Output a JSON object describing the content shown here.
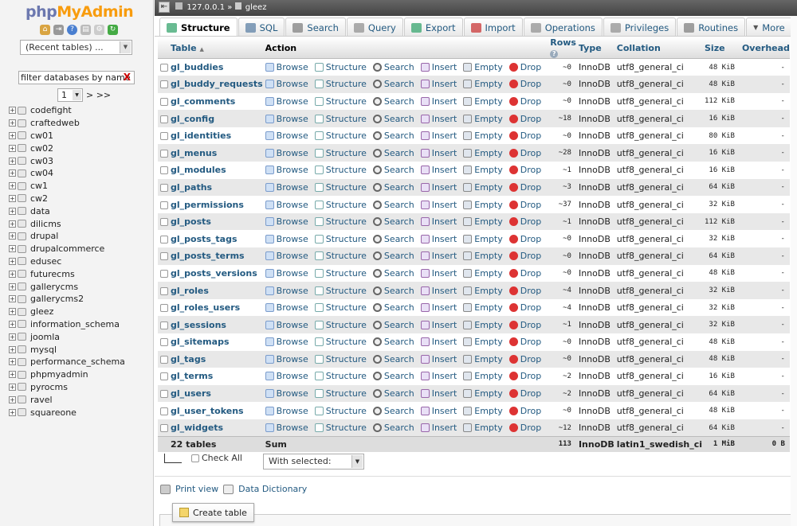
{
  "sidebar": {
    "logo_part1": "php",
    "logo_part2": "MyAdmin",
    "recent_tables": "(Recent tables) ...",
    "filter_placeholder": "filter databases by name",
    "filter_clear": "X",
    "page": "1",
    "page_next": "> >>",
    "databases": [
      "codefight",
      "craftedweb",
      "cw01",
      "cw02",
      "cw03",
      "cw04",
      "cw1",
      "cw2",
      "data",
      "dilicms",
      "drupal",
      "drupalcommerce",
      "edusec",
      "futurecms",
      "gallerycms",
      "gallerycms2",
      "gleez",
      "information_schema",
      "joomla",
      "mysql",
      "performance_schema",
      "phpmyadmin",
      "pyrocms",
      "ravel",
      "squareone"
    ]
  },
  "breadcrumb": {
    "server": "127.0.0.1",
    "sep": "»",
    "database": "gleez"
  },
  "tabs": [
    {
      "label": "Structure",
      "active": true,
      "color": "#4a7"
    },
    {
      "label": "SQL",
      "active": false,
      "color": "#68a"
    },
    {
      "label": "Search",
      "active": false,
      "color": "#888"
    },
    {
      "label": "Query",
      "active": false,
      "color": "#999"
    },
    {
      "label": "Export",
      "active": false,
      "color": "#4a7"
    },
    {
      "label": "Import",
      "active": false,
      "color": "#c44"
    },
    {
      "label": "Operations",
      "active": false,
      "color": "#999"
    },
    {
      "label": "Privileges",
      "active": false,
      "color": "#999"
    },
    {
      "label": "Routines",
      "active": false,
      "color": "#888"
    },
    {
      "label": "More",
      "active": false,
      "color": "#fff"
    }
  ],
  "table_headers": {
    "table": "Table",
    "action": "Action",
    "rows": "Rows",
    "type": "Type",
    "collation": "Collation",
    "size": "Size",
    "overhead": "Overhead"
  },
  "actions": {
    "browse": "Browse",
    "structure": "Structure",
    "search": "Search",
    "insert": "Insert",
    "empty": "Empty",
    "drop": "Drop"
  },
  "tables": [
    {
      "name": "gl_buddies",
      "rows": "~0",
      "type": "InnoDB",
      "collation": "utf8_general_ci",
      "size": "48 KiB",
      "overhead": "-"
    },
    {
      "name": "gl_buddy_requests",
      "rows": "~0",
      "type": "InnoDB",
      "collation": "utf8_general_ci",
      "size": "48 KiB",
      "overhead": "-"
    },
    {
      "name": "gl_comments",
      "rows": "~0",
      "type": "InnoDB",
      "collation": "utf8_general_ci",
      "size": "112 KiB",
      "overhead": "-"
    },
    {
      "name": "gl_config",
      "rows": "~18",
      "type": "InnoDB",
      "collation": "utf8_general_ci",
      "size": "16 KiB",
      "overhead": "-"
    },
    {
      "name": "gl_identities",
      "rows": "~0",
      "type": "InnoDB",
      "collation": "utf8_general_ci",
      "size": "80 KiB",
      "overhead": "-"
    },
    {
      "name": "gl_menus",
      "rows": "~28",
      "type": "InnoDB",
      "collation": "utf8_general_ci",
      "size": "16 KiB",
      "overhead": "-"
    },
    {
      "name": "gl_modules",
      "rows": "~1",
      "type": "InnoDB",
      "collation": "utf8_general_ci",
      "size": "16 KiB",
      "overhead": "-"
    },
    {
      "name": "gl_paths",
      "rows": "~3",
      "type": "InnoDB",
      "collation": "utf8_general_ci",
      "size": "64 KiB",
      "overhead": "-"
    },
    {
      "name": "gl_permissions",
      "rows": "~37",
      "type": "InnoDB",
      "collation": "utf8_general_ci",
      "size": "32 KiB",
      "overhead": "-"
    },
    {
      "name": "gl_posts",
      "rows": "~1",
      "type": "InnoDB",
      "collation": "utf8_general_ci",
      "size": "112 KiB",
      "overhead": "-"
    },
    {
      "name": "gl_posts_tags",
      "rows": "~0",
      "type": "InnoDB",
      "collation": "utf8_general_ci",
      "size": "32 KiB",
      "overhead": "-"
    },
    {
      "name": "gl_posts_terms",
      "rows": "~0",
      "type": "InnoDB",
      "collation": "utf8_general_ci",
      "size": "64 KiB",
      "overhead": "-"
    },
    {
      "name": "gl_posts_versions",
      "rows": "~0",
      "type": "InnoDB",
      "collation": "utf8_general_ci",
      "size": "48 KiB",
      "overhead": "-"
    },
    {
      "name": "gl_roles",
      "rows": "~4",
      "type": "InnoDB",
      "collation": "utf8_general_ci",
      "size": "32 KiB",
      "overhead": "-"
    },
    {
      "name": "gl_roles_users",
      "rows": "~4",
      "type": "InnoDB",
      "collation": "utf8_general_ci",
      "size": "32 KiB",
      "overhead": "-"
    },
    {
      "name": "gl_sessions",
      "rows": "~1",
      "type": "InnoDB",
      "collation": "utf8_general_ci",
      "size": "32 KiB",
      "overhead": "-"
    },
    {
      "name": "gl_sitemaps",
      "rows": "~0",
      "type": "InnoDB",
      "collation": "utf8_general_ci",
      "size": "48 KiB",
      "overhead": "-"
    },
    {
      "name": "gl_tags",
      "rows": "~0",
      "type": "InnoDB",
      "collation": "utf8_general_ci",
      "size": "48 KiB",
      "overhead": "-"
    },
    {
      "name": "gl_terms",
      "rows": "~2",
      "type": "InnoDB",
      "collation": "utf8_general_ci",
      "size": "16 KiB",
      "overhead": "-"
    },
    {
      "name": "gl_users",
      "rows": "~2",
      "type": "InnoDB",
      "collation": "utf8_general_ci",
      "size": "64 KiB",
      "overhead": "-"
    },
    {
      "name": "gl_user_tokens",
      "rows": "~0",
      "type": "InnoDB",
      "collation": "utf8_general_ci",
      "size": "48 KiB",
      "overhead": "-"
    },
    {
      "name": "gl_widgets",
      "rows": "~12",
      "type": "InnoDB",
      "collation": "utf8_general_ci",
      "size": "64 KiB",
      "overhead": "-"
    }
  ],
  "summary": {
    "tables": "22 tables",
    "label": "Sum",
    "rows": "113",
    "type": "InnoDB",
    "collation": "latin1_swedish_ci",
    "size": "1 MiB",
    "overhead": "0 B"
  },
  "footer": {
    "check_all": "Check All",
    "with_selected": "With selected:",
    "print_view": "Print view",
    "data_dictionary": "Data Dictionary",
    "create_table": "Create table"
  }
}
